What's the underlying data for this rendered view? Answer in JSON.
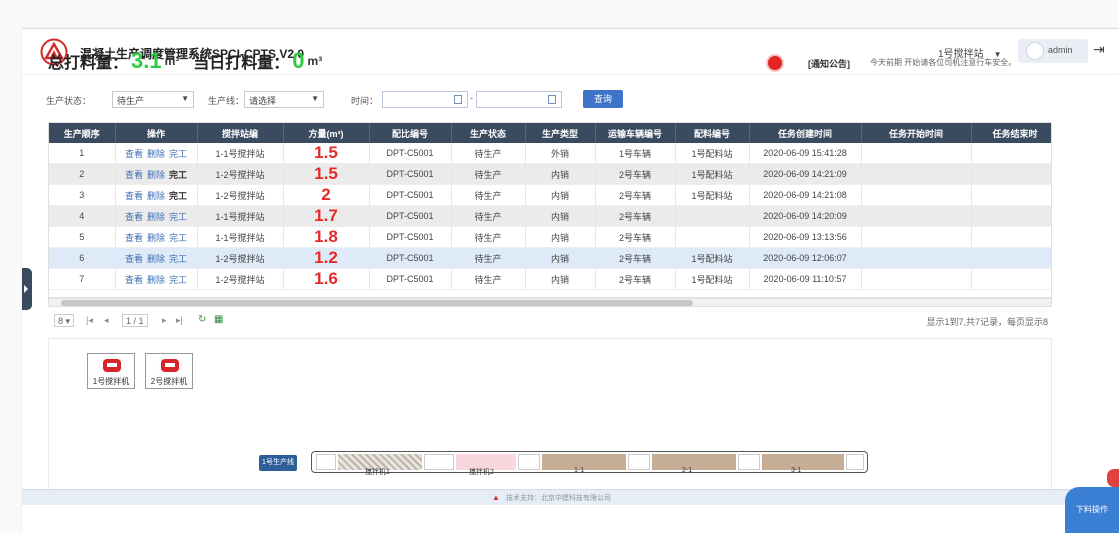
{
  "header": {
    "title": "混凝土生产调度管理系统SPCI-CPTS V2.0",
    "station": "1号搅拌站",
    "user": "admin"
  },
  "stats": {
    "total_label": "总打料量：",
    "total_value": "3.1",
    "total_unit": "m³",
    "today_label": "当日打料量：",
    "today_value": "0",
    "today_unit": "m³"
  },
  "notice": {
    "label": "[通知公告]",
    "text": "今天前期 开始请各位司机注意行车安全。"
  },
  "filters": {
    "status_label": "生产状态：",
    "status_value": "待生产",
    "line_label": "生产线：",
    "line_value": "请选择",
    "time_label": "时间：",
    "query_label": "查询"
  },
  "table": {
    "columns": [
      "生产顺序",
      "操作",
      "搅拌站编",
      "方量(m³)",
      "配比编号",
      "生产状态",
      "生产类型",
      "运输车辆编号",
      "配料编号",
      "任务创建时间",
      "任务开始时间",
      "任务结束时"
    ],
    "rows": [
      {
        "seq": "1",
        "ops": [
          "查看",
          "删除",
          "完工"
        ],
        "station": "1-1号搅拌站",
        "volume": "1.5",
        "mix": "DPT-C5001",
        "status": "待生产",
        "type": "外销",
        "vehicle": "1号车辆",
        "batch": "1号配料站",
        "created": "2020-06-09 15:41:28",
        "start": "",
        "end": ""
      },
      {
        "seq": "2",
        "ops": [
          "查看",
          "删除",
          "完工"
        ],
        "station": "1-2号搅拌站",
        "volume": "1.5",
        "mix": "DPT-C5001",
        "status": "待生产",
        "type": "内销",
        "vehicle": "2号车辆",
        "batch": "1号配料站",
        "created": "2020-06-09 14:21:09",
        "start": "",
        "end": ""
      },
      {
        "seq": "3",
        "ops": [
          "查看",
          "删除",
          "完工"
        ],
        "station": "1-2号搅拌站",
        "volume": "2",
        "mix": "DPT-C5001",
        "status": "待生产",
        "type": "内销",
        "vehicle": "2号车辆",
        "batch": "1号配料站",
        "created": "2020-06-09 14:21:08",
        "start": "",
        "end": ""
      },
      {
        "seq": "4",
        "ops": [
          "查看",
          "删除",
          "完工"
        ],
        "station": "1-1号搅拌站",
        "volume": "1.7",
        "mix": "DPT-C5001",
        "status": "待生产",
        "type": "内销",
        "vehicle": "2号车辆",
        "batch": "",
        "created": "2020-06-09 14:20:09",
        "start": "",
        "end": ""
      },
      {
        "seq": "5",
        "ops": [
          "查看",
          "删除",
          "完工"
        ],
        "station": "1-1号搅拌站",
        "volume": "1.8",
        "mix": "DPT-C5001",
        "status": "待生产",
        "type": "内销",
        "vehicle": "2号车辆",
        "batch": "",
        "created": "2020-06-09 13:13:56",
        "start": "",
        "end": ""
      },
      {
        "seq": "6",
        "ops": [
          "查看",
          "删除",
          "完工"
        ],
        "station": "1-2号搅拌站",
        "volume": "1.2",
        "mix": "DPT-C5001",
        "status": "待生产",
        "type": "内销",
        "vehicle": "2号车辆",
        "batch": "1号配料站",
        "created": "2020-06-09 12:06:07",
        "start": "",
        "end": ""
      },
      {
        "seq": "7",
        "ops": [
          "查看",
          "删除",
          "完工"
        ],
        "station": "1-2号搅拌站",
        "volume": "1.6",
        "mix": "DPT-C5001",
        "status": "待生产",
        "type": "内销",
        "vehicle": "2号车辆",
        "batch": "1号配料站",
        "created": "2020-06-09 11:10:57",
        "start": "",
        "end": ""
      }
    ]
  },
  "pager": {
    "page_size": "8",
    "page_box": "1 / 1",
    "info": "显示1到7,共7记录，每页显示8"
  },
  "mixers": [
    {
      "label": "1号搅拌机"
    },
    {
      "label": "2号搅拌机"
    }
  ],
  "line": {
    "button_label": "1号生产线",
    "labels": [
      "搅拌机1",
      "搅拌机2",
      "1-1",
      "2-1",
      "3-1"
    ]
  },
  "footer": {
    "text": "技术支持：北京中建科技有限公司"
  },
  "fab": {
    "label": "下料操作"
  },
  "colors": {
    "header_dark": "#3a4a5f",
    "accent_blue": "#3d74c9",
    "value_green": "#2ecc40",
    "volume_red": "#e52a2a"
  }
}
